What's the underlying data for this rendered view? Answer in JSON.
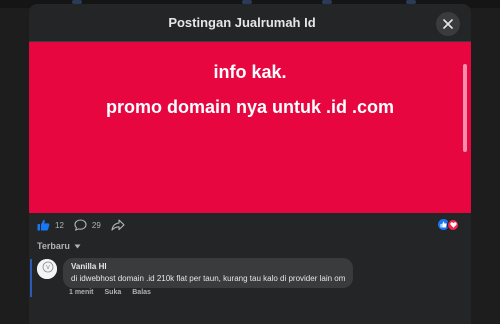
{
  "modal": {
    "title": "Postingan Jualrumah Id"
  },
  "post": {
    "line1": "info kak.",
    "line2": "promo domain nya untuk .id .com",
    "background": "#e80641"
  },
  "actions": {
    "likes": "12",
    "comments": "29"
  },
  "sort": {
    "label": "Terbaru"
  },
  "comment": {
    "author": "Vanilla Hl",
    "text": "di idwebhost domain .id 210k flat per taun, kurang tau kalo di provider lain om",
    "time": "1 menit",
    "like_label": "Suka",
    "reply_label": "Balas"
  },
  "colors": {
    "like": "#1877f2",
    "love": "#f0284a",
    "panel": "#242526"
  }
}
